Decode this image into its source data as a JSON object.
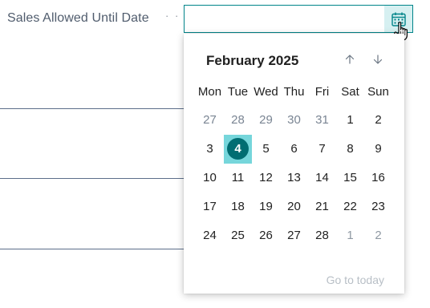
{
  "field": {
    "label": "Sales Allowed Until Date",
    "leader": "· ·",
    "value": "",
    "placeholder": ""
  },
  "calendar": {
    "month_title": "February 2025",
    "weekdays": [
      "Mon",
      "Tue",
      "Wed",
      "Thu",
      "Fri",
      "Sat",
      "Sun"
    ],
    "weeks": [
      [
        "27",
        "28",
        "29",
        "30",
        "31",
        "1",
        "2"
      ],
      [
        "3",
        "4",
        "5",
        "6",
        "7",
        "8",
        "9"
      ],
      [
        "10",
        "11",
        "12",
        "13",
        "14",
        "15",
        "16"
      ],
      [
        "17",
        "18",
        "19",
        "20",
        "21",
        "22",
        "23"
      ],
      [
        "24",
        "25",
        "26",
        "27",
        "28",
        "1",
        "2"
      ]
    ],
    "selected_day": "4",
    "go_to_today": "Go to today"
  },
  "icons": {
    "calendar_button": "calendar-icon",
    "prev_month": "arrow-up-icon",
    "next_month": "arrow-down-icon",
    "cursor": "hand-pointer-icon"
  },
  "colors": {
    "accent": "#008489",
    "selected_day_circle": "#006d72",
    "selected_day_background": "#76d6db",
    "calendar_button_background": "#d6f0f1",
    "disabled_text": "#b8bfc6",
    "divider": "#5c6e8a"
  }
}
